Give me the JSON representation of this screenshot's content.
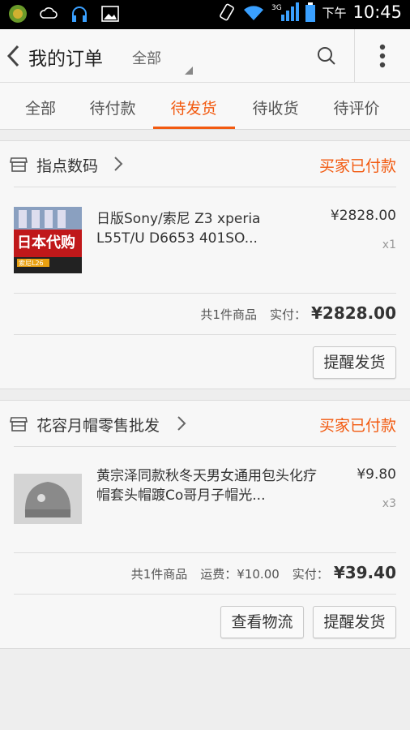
{
  "status_bar": {
    "ampm": "下午",
    "time": "10:45",
    "network": "3G"
  },
  "header": {
    "back_icon": "back-arrow-icon",
    "title": "我的订单",
    "filter_label": "全部",
    "search_icon": "search-icon",
    "more_icon": "more-vertical-icon"
  },
  "tabs": [
    {
      "label": "全部",
      "active": false
    },
    {
      "label": "待付款",
      "active": false
    },
    {
      "label": "待发货",
      "active": true
    },
    {
      "label": "待收货",
      "active": false
    },
    {
      "label": "待评价",
      "active": false
    }
  ],
  "orders": [
    {
      "store": "指点数码",
      "status": "买家已付款",
      "item": {
        "name": "日版Sony/索尼 Z3 xperia L55T/U D6653 401SO...",
        "price": "¥2828.00",
        "qty": "x1",
        "thumb_text": "日本代购",
        "thumb_sub": "索尼L26"
      },
      "summary": {
        "count_label": "共1件商品",
        "total_label": "实付：",
        "total": "¥2828.00"
      },
      "buttons": [
        "提醒发货"
      ]
    },
    {
      "store": "花容月帽零售批发",
      "status": "买家已付款",
      "item": {
        "name": "黄宗泽同款秋冬天男女通用包头化疗帽套头帽踱Co哥月子帽光...",
        "price": "¥9.80",
        "qty": "x3"
      },
      "summary": {
        "count_label": "共1件商品",
        "shipping_label": "运费：¥10.00",
        "total_label": "实付：",
        "total": "¥39.40"
      },
      "buttons": [
        "查看物流",
        "提醒发货"
      ]
    }
  ],
  "colors": {
    "accent": "#f25a10",
    "background": "#eeeeee",
    "card": "#f7f7f7"
  }
}
